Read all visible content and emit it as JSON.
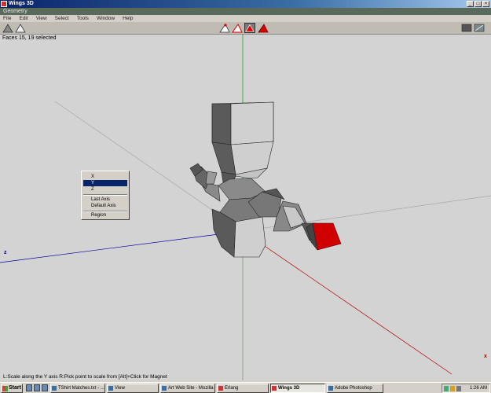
{
  "window": {
    "title": "Wings 3D"
  },
  "geometry_bar": {
    "label": "Geometry"
  },
  "menu": [
    "File",
    "Edit",
    "View",
    "Select",
    "Tools",
    "Window",
    "Help"
  ],
  "viewport": {
    "info": "Faces 15, 19 selected",
    "axis_z_label": "z",
    "axis_x_label": "x"
  },
  "context_menu": {
    "items": [
      "X",
      "Y",
      "Z",
      "Last Axis",
      "Default Axis",
      "Region"
    ],
    "selected": "Y"
  },
  "status": {
    "text": "L:Scale along the Y axis   R:Pick point to scale from   [Alt]+Click for Magnet"
  },
  "taskbar": {
    "start_label": "Start",
    "buttons": [
      {
        "label": "TShirt Matches.txt - ...",
        "active": false
      },
      {
        "label": "View",
        "active": false
      },
      {
        "label": "Art Web Site - Mozilla",
        "active": false
      },
      {
        "label": "Erlang",
        "active": false
      },
      {
        "label": "Wings 3D",
        "active": true
      },
      {
        "label": "Adobe Photoshop",
        "active": false
      }
    ],
    "clock": "1:26 AM"
  },
  "colors": {
    "selection_red": "#d00000",
    "axis_y": "#00a000",
    "axis_x": "#b00000",
    "axis_z": "#0000a0",
    "viewport_bg": "#d3d3d3"
  }
}
